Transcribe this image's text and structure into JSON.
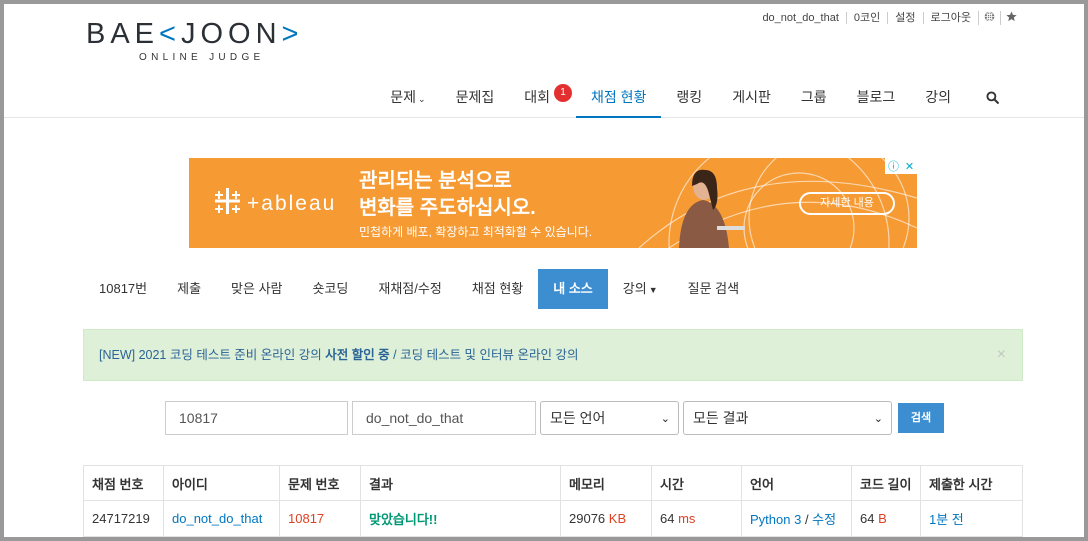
{
  "logo": {
    "main": "BAE",
    "bracket_left": "<",
    "main2": "JOON",
    "bracket_right": ">",
    "sub": "ONLINE JUDGE"
  },
  "toplinks": [
    "do_not_do_that",
    "0코인",
    "설정",
    "로그아웃"
  ],
  "toplink_icons": [
    "globe-icon",
    "star-icon"
  ],
  "mainnav": [
    {
      "label": "문제",
      "dropdown": true
    },
    {
      "label": "문제집"
    },
    {
      "label": "대회",
      "badge": "1"
    },
    {
      "label": "채점 현황",
      "active": true
    },
    {
      "label": "랭킹"
    },
    {
      "label": "게시판"
    },
    {
      "label": "그룹"
    },
    {
      "label": "블로그"
    },
    {
      "label": "강의"
    }
  ],
  "ad": {
    "brand": "+ableau",
    "headline1": "관리되는 분석으로",
    "headline2": "변화를 주도하십시오.",
    "sub": "민첩하게 배포, 확장하고 최적화할 수 있습니다.",
    "cta": "자세한 내용"
  },
  "subnav": [
    {
      "label": "10817번"
    },
    {
      "label": "제출"
    },
    {
      "label": "맞은 사람"
    },
    {
      "label": "숏코딩"
    },
    {
      "label": "재채점/수정"
    },
    {
      "label": "채점 현황"
    },
    {
      "label": "내 소스",
      "active": true
    },
    {
      "label": "강의",
      "dropdown": true
    },
    {
      "label": "질문 검색"
    }
  ],
  "notice": {
    "part1": "[NEW] 2021 코딩 테스트 준비 온라인 강의 ",
    "bold": "사전 할인 중",
    "part2": " / 코딩 테스트 및 인터뷰 온라인 강의",
    "close": "×"
  },
  "search": {
    "problem_value": "10817",
    "user_value": "do_not_do_that",
    "language_selected": "모든 언어",
    "result_selected": "모든 결과",
    "button": "검색"
  },
  "table": {
    "headers": [
      "채점 번호",
      "아이디",
      "문제 번호",
      "결과",
      "메모리",
      "시간",
      "언어",
      "코드 길이",
      "제출한 시간"
    ],
    "rows": [
      {
        "submission_id": "24717219",
        "user": "do_not_do_that",
        "problem": "10817",
        "result": "맞았습니다!!",
        "memory": "29076",
        "memory_unit": "KB",
        "time": "64",
        "time_unit": "ms",
        "language": "Python 3",
        "language_sep": " / ",
        "edit": "수정",
        "code_length": "64",
        "code_unit": "B",
        "submitted": "1분 전"
      }
    ]
  },
  "colors": {
    "accent": "#0076c0",
    "active_tab": "#3c8ed1",
    "correct": "#009874",
    "ad_bg": "#f69a33",
    "badge": "#e32f2f"
  }
}
